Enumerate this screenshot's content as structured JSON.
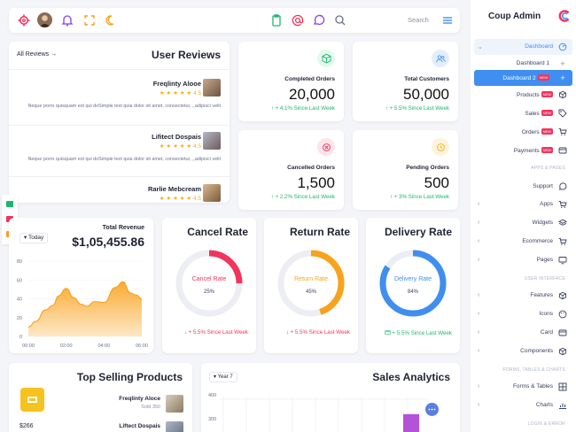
{
  "topbar": {
    "search_placeholder": "Search",
    "icons": [
      "settings-icon",
      "avatar",
      "bell-icon",
      "fullscreen-icon",
      "moon-icon",
      "clipboard-icon",
      "at-icon",
      "chat-icon",
      "search-icon",
      "menu-icon"
    ]
  },
  "brand": {
    "title": "Coup Admin",
    "logo": "C"
  },
  "sidebar": {
    "items": [
      {
        "label": "Dashboard",
        "icon": "gauge-icon",
        "expanded": true
      },
      {
        "label": "Dashboard 1"
      },
      {
        "label": "Dashboard 2",
        "badge": "NEW",
        "active": true
      },
      {
        "label": "Products",
        "badge": "NEW",
        "icon": "box-icon"
      },
      {
        "label": "Sales",
        "badge": "NEW",
        "icon": "tag-icon"
      },
      {
        "label": "Orders",
        "badge": "NEW",
        "icon": "cart-icon"
      },
      {
        "label": "Payments",
        "badge": "NEW",
        "icon": "card-icon"
      },
      {
        "label": "Support",
        "icon": "chat-icon"
      },
      {
        "label": "Apps",
        "icon": "cart-icon"
      },
      {
        "label": "Widgets",
        "icon": "layers-icon"
      },
      {
        "label": "Ecommerce",
        "icon": "cart-icon"
      },
      {
        "label": "Pages",
        "icon": "monitor-icon"
      },
      {
        "label": "Features",
        "icon": "box-icon"
      },
      {
        "label": "Icons",
        "icon": "palette-icon"
      },
      {
        "label": "Card",
        "icon": "card-icon"
      },
      {
        "label": "Components",
        "icon": "box-icon"
      },
      {
        "label": "Forms & Tables",
        "icon": "grid-icon"
      },
      {
        "label": "Charts",
        "icon": "chart-icon"
      }
    ],
    "sections": {
      "apps": "APPS & PAGES",
      "ui": "USER INTERFACE",
      "forms": "FORMS, TABLES & CHARTS",
      "login": "LOGIN & ERROR"
    }
  },
  "reviews": {
    "link": "All Reviews →",
    "title": "User Reviews",
    "items": [
      {
        "name": "Freqlinty Alooe",
        "stars": "★ ★ ★ ★ ★ 4.5",
        "text": "Neque porro quisquam est qui doSimple text quia dolor sit amet, consectetur, ,,adipisci velit"
      },
      {
        "name": "Lifitect Dospais",
        "stars": "★ ★ ★ ★ ★ 4.5",
        "text": "Neque porro quisquam est qui doSimple text quia dolor sit amet, consectetur, ,,adipisci velit"
      },
      {
        "name": "Rarlie Mebcream",
        "stars": "★ ★ ★ ★ ★ 4.5"
      }
    ]
  },
  "stats": [
    {
      "title": "Completed Orders",
      "value": "20,000",
      "trend": "↑ + 4.1% Since Last Week",
      "icon": "cube-icon",
      "color": "#1bb76e",
      "bg": "#e3f8ee"
    },
    {
      "title": "Total Customers",
      "value": "50,000",
      "trend": "↑ + 5.5% Since Last Week",
      "icon": "users-icon",
      "color": "#3f8ef0",
      "bg": "#e3eefc"
    },
    {
      "title": "Cancelled Orders",
      "value": "1,500",
      "trend": "↑ + 2.2% Since Last Week",
      "icon": "x-circle-icon",
      "color": "#f0355d",
      "bg": "#fde4ea"
    },
    {
      "title": "Pending Orders",
      "value": "500",
      "trend": "↑ + 3% Since Last Week",
      "icon": "clock-icon",
      "color": "#f6b01e",
      "bg": "#fdf3dc"
    }
  ],
  "revenue": {
    "period": "Today",
    "label": "Total Revenue",
    "value": "$1,05,455.86"
  },
  "chart_data": {
    "type": "area",
    "x": [
      "00:00",
      "02:00",
      "04:00",
      "06:00"
    ],
    "y_ticks": [
      0,
      20,
      40,
      60,
      80
    ],
    "ylim": [
      0,
      80
    ],
    "points_x": [
      0,
      0.4,
      0.9,
      1.3,
      1.6,
      2.0,
      2.4,
      2.8,
      3.1,
      3.5,
      4.0,
      4.6,
      5.0,
      5.4,
      5.7,
      6.0
    ],
    "points_y": [
      10,
      16,
      28,
      33,
      43,
      51,
      41,
      34,
      32,
      37,
      36,
      52,
      58,
      46,
      44,
      40
    ],
    "color": "#f9a21b"
  },
  "rates": [
    {
      "title": "Cancel Rate",
      "label": "Cancel Rate",
      "percent": 25,
      "trend": "↓ + 5.5% Since Last Week",
      "color": "#f0355d",
      "trend_color": "#f0355d"
    },
    {
      "title": "Return Rate",
      "label": "Return Rate",
      "percent": 45,
      "trend": "↓ + 5.5% Since Last Week",
      "color": "#f9a21b",
      "trend_color": "#f0355d"
    },
    {
      "title": "Delivery Rate",
      "label": "Delivery Rate",
      "percent": 84,
      "trend": "+ 5.5% Since Last Week",
      "color": "#3f8ef0",
      "trend_color": "#1bb76e",
      "trend_icon": "card-icon"
    }
  ],
  "top_selling": {
    "title": "Top Selling Products",
    "price": "$266",
    "items": [
      {
        "name": "Freqlinty Aloce",
        "sub": "Sold 350"
      },
      {
        "name": "Liftect Dospais"
      }
    ]
  },
  "sales_analytics": {
    "title": "Sales Analytics",
    "period": "Year 7",
    "y_ticks": [
      "400",
      "300"
    ],
    "bars": [
      {
        "value": 0.3,
        "color": "#3f8ef0"
      },
      {
        "value": 0.55,
        "color": "#b552d8"
      }
    ]
  },
  "floating_icons": [
    "green-card-icon",
    "red-card-icon",
    "yellow-card-icon"
  ]
}
